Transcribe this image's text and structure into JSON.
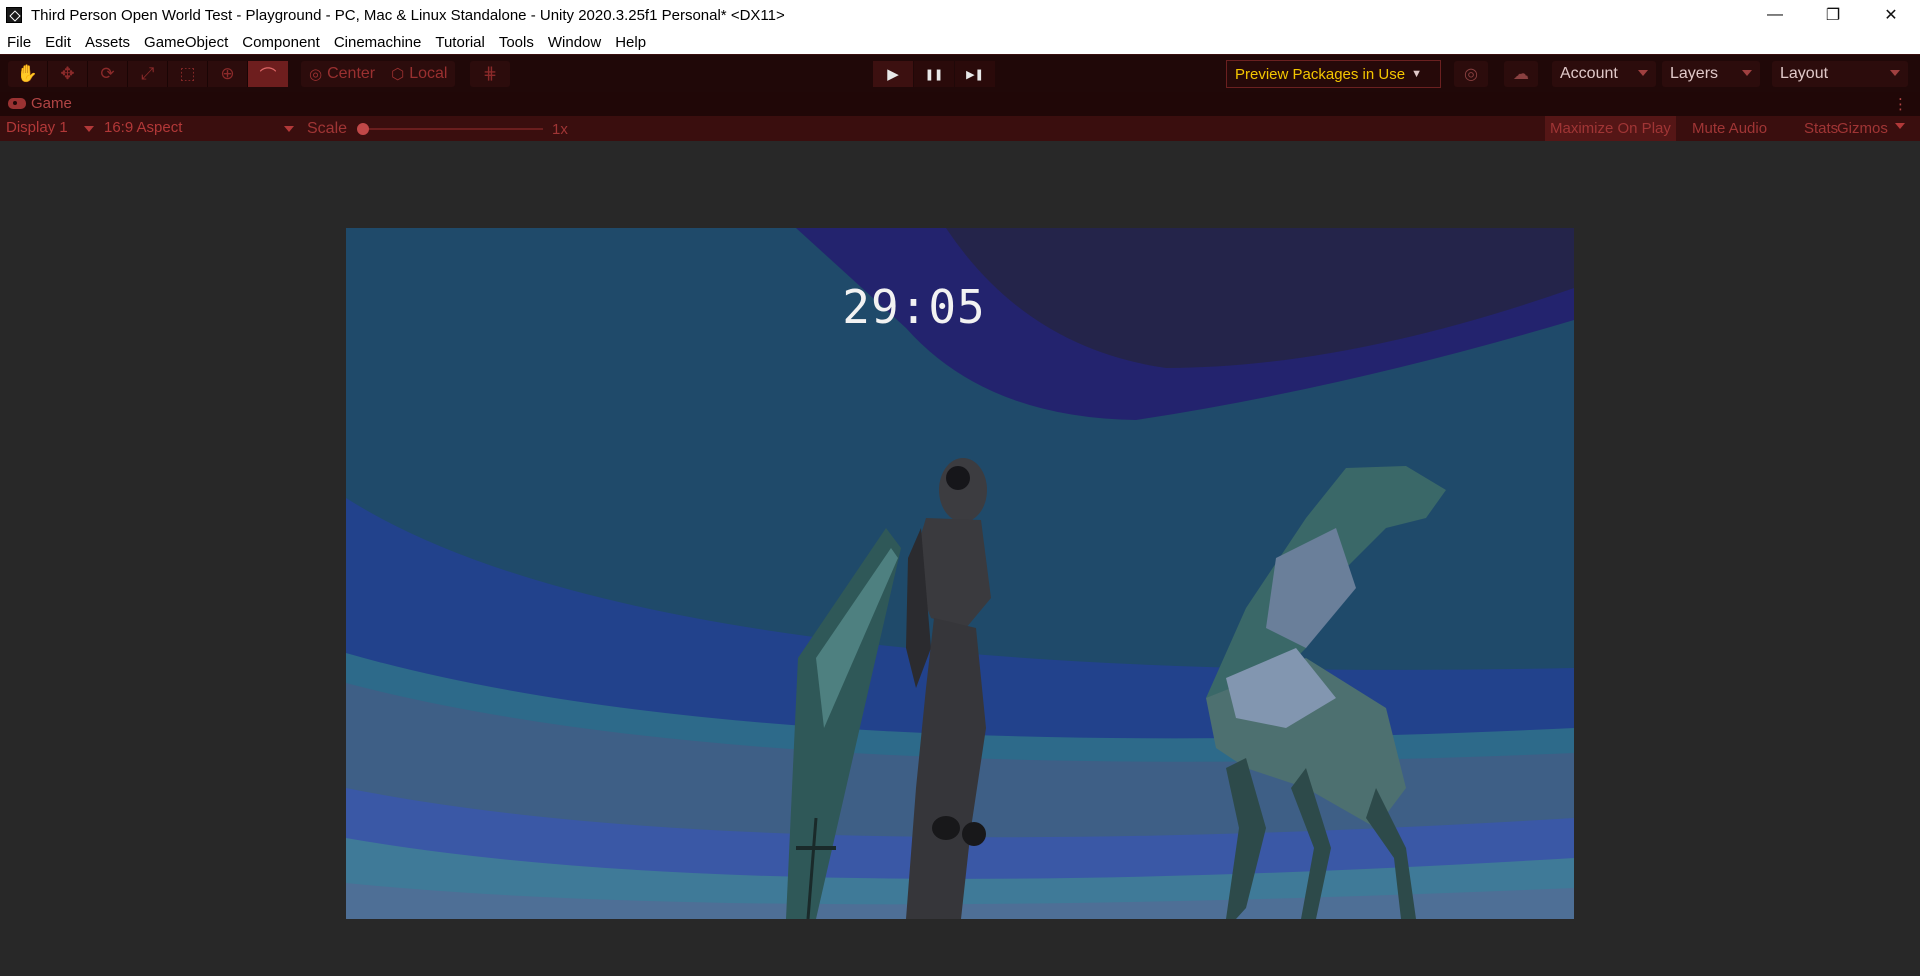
{
  "window": {
    "title": "Third Person Open World Test - Playground - PC, Mac & Linux Standalone - Unity 2020.3.25f1 Personal* <DX11>",
    "controls": {
      "minimize": "—",
      "maximize": "❐",
      "close": "✕"
    }
  },
  "menu": [
    "File",
    "Edit",
    "Assets",
    "GameObject",
    "Component",
    "Cinemachine",
    "Tutorial",
    "Tools",
    "Window",
    "Help"
  ],
  "toolbar": {
    "tools": [
      "hand-tool-icon",
      "move-tool-icon",
      "rotate-tool-icon",
      "scale-tool-icon",
      "rect-tool-icon",
      "transform-tool-icon",
      "custom-tool-icon"
    ],
    "pivot_mode": "Center",
    "pivot_rotation": "Local",
    "play": "▶",
    "pause": "❚❚",
    "step": "▶❚",
    "preview_packages": "Preview Packages in Use",
    "account": "Account",
    "layers": "Layers",
    "layout": "Layout"
  },
  "game_tab": {
    "label": "Game",
    "display": "Display 1",
    "aspect": "16:9 Aspect",
    "scale_label": "Scale",
    "scale_value": "1x",
    "scale_fraction": 0.0,
    "maximize_on_play": "Maximize On Play",
    "mute_audio": "Mute Audio",
    "stats": "Stats",
    "gizmos": "Gizmos"
  },
  "game_view": {
    "timer": "29:05"
  },
  "colors": {
    "toolbar_bg": "#200808",
    "accent_red": "#b14545",
    "preview_text": "#f4c600",
    "sky_main": "#1f4a6a",
    "sky_dark": "#22224a",
    "band_blue": "#23418a"
  }
}
